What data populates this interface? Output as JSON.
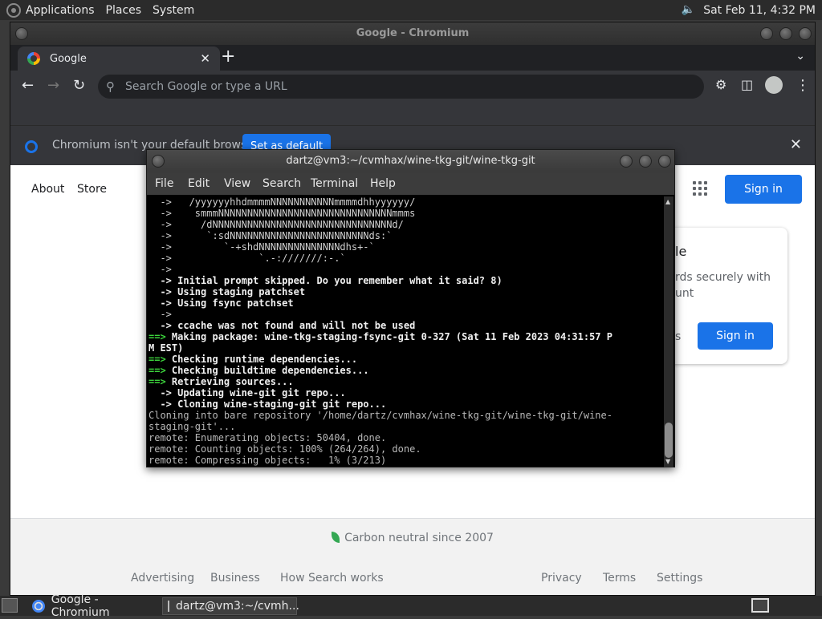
{
  "top_panel": {
    "menus": [
      "Applications",
      "Places",
      "System"
    ],
    "clock": "Sat Feb 11,  4:32 PM"
  },
  "chromium": {
    "window_title": "Google - Chromium",
    "tab_title": "Google",
    "omnibox_placeholder": "Search Google or type a URL",
    "infobar_message": "Chromium isn't your default browser",
    "infobar_button": "Set as default",
    "page": {
      "nav_left": [
        "About",
        "Store"
      ],
      "sign_in": "Sign in",
      "card_title": "le",
      "card_text": "rds securely with\nunt",
      "card_partial": "s",
      "card_sign_in": "Sign in",
      "carbon": "Carbon neutral since 2007",
      "footer_left": [
        "Advertising",
        "Business",
        "How Search works"
      ],
      "footer_right": [
        "Privacy",
        "Terms",
        "Settings"
      ]
    }
  },
  "terminal": {
    "window_title": "dartz@vm3:~/cvmhax/wine-tkg-git/wine-tkg-git",
    "menus": [
      "File",
      "Edit",
      "View",
      "Search",
      "Terminal",
      "Help"
    ],
    "lines": [
      {
        "t": "arrow",
        "text": "  ->   /yyyyyyhhdmmmmNNNNNNNNNNNmmmmdhhyyyyyy/"
      },
      {
        "t": "arrow",
        "text": "  ->    smmmNNNNNNNNNNNNNNNNNNNNNNNNNNNNNNmmms"
      },
      {
        "t": "arrow",
        "text": "  ->     /dNNNNNNNNNNNNNNNNNNNNNNNNNNNNNNNd/"
      },
      {
        "t": "arrow",
        "text": "  ->      `:sdNNNNNNNNNNNNNNNNNNNNNNNNds:`"
      },
      {
        "t": "arrow",
        "text": "  ->         `-+shdNNNNNNNNNNNNNNdhs+-`"
      },
      {
        "t": "arrow",
        "text": "  ->               `.-:///////:-.`"
      },
      {
        "t": "arrow",
        "text": "  ->"
      },
      {
        "t": "bold",
        "text": "  -> Initial prompt skipped. Do you remember what it said? 8)"
      },
      {
        "t": "bold",
        "text": "  -> Using staging patchset"
      },
      {
        "t": "bold",
        "text": "  -> Using fsync patchset"
      },
      {
        "t": "arrow",
        "text": "  ->"
      },
      {
        "t": "bold",
        "text": "  -> ccache was not found and will not be used"
      },
      {
        "t": "green",
        "prefix": "==>",
        "text": " Making package: wine-tkg-staging-fsync-git 0-327 (Sat 11 Feb 2023 04:31:57 P"
      },
      {
        "t": "bold",
        "text": "M EST)"
      },
      {
        "t": "green",
        "prefix": "==>",
        "text": " Checking runtime dependencies..."
      },
      {
        "t": "green",
        "prefix": "==>",
        "text": " Checking buildtime dependencies..."
      },
      {
        "t": "green",
        "prefix": "==>",
        "text": " Retrieving sources..."
      },
      {
        "t": "bold",
        "text": "  -> Updating wine-git git repo..."
      },
      {
        "t": "bold",
        "text": "  -> Cloning wine-staging-git git repo..."
      },
      {
        "t": "plain",
        "text": "Cloning into bare repository '/home/dartz/cvmhax/wine-tkg-git/wine-tkg-git/wine-"
      },
      {
        "t": "plain",
        "text": "staging-git'..."
      },
      {
        "t": "plain",
        "text": "remote: Enumerating objects: 50404, done."
      },
      {
        "t": "plain",
        "text": "remote: Counting objects: 100% (264/264), done."
      },
      {
        "t": "plain",
        "text": "remote: Compressing objects:   1% (3/213)"
      }
    ]
  },
  "bottom_panel": {
    "tasks": [
      "Google - Chromium",
      "dartz@vm3:~/cvmh..."
    ]
  }
}
